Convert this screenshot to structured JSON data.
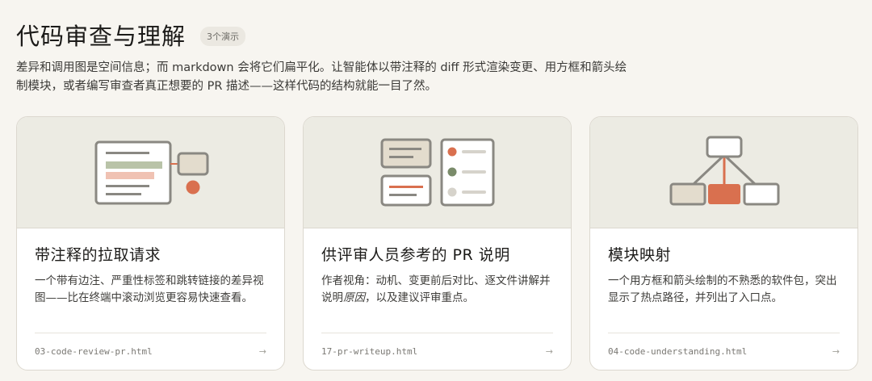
{
  "header": {
    "title": "代码审查与理解",
    "badge": "3个演示"
  },
  "description": "差异和调用图是空间信息；而 markdown 会将它们扁平化。让智能体以带注释的 diff 形式渲染变更、用方框和箭头绘制模块，或者编写审查者真正想要的 PR 描述——这样代码的结构就能一目了然。",
  "colors": {
    "accent": "#d9704f",
    "green": "#7a8b6a",
    "box_fill": "#e3dccd",
    "stroke": "#8a8882"
  },
  "cards": [
    {
      "title": "带注释的拉取请求",
      "text": "一个带有边注、严重性标签和跳转链接的差异视图——比在终端中滚动浏览更容易快速查看。",
      "file": "03-code-review-pr.html",
      "arrow": "→"
    },
    {
      "title": "供评审人员参考的 PR 说明",
      "text_before": "作者视角：动机、变更前后对比、逐文件讲解并说明",
      "text_em": "原因",
      "text_after": "，以及建议评审重点。",
      "file": "17-pr-writeup.html",
      "arrow": "→"
    },
    {
      "title": "模块映射",
      "text": "一个用方框和箭头绘制的不熟悉的软件包，突出显示了热点路径，并列出了入口点。",
      "file": "04-code-understanding.html",
      "arrow": "→"
    }
  ]
}
